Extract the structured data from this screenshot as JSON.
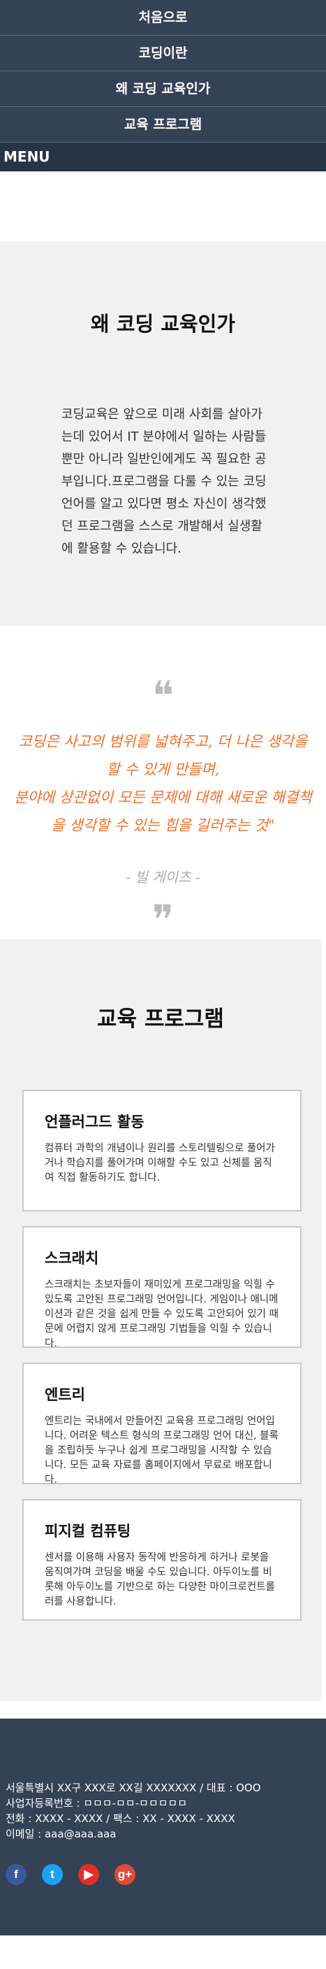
{
  "nav": {
    "items": [
      {
        "label": "처음으로"
      },
      {
        "label": "코딩이란"
      },
      {
        "label": "왜 코딩 교육인가"
      },
      {
        "label": "교육 프로그램"
      }
    ],
    "menu_label": "MENU"
  },
  "why": {
    "title": "왜 코딩 교육인가",
    "body": "코딩교육은 앞으로 미래 사회를 살아가는데 있어서 IT 분야에서 일하는 사람들 뿐만 아니라 일반인에게도 꼭 필요한 공부입니다.프로그램을 다룰 수 있는 코딩 언어를 알고 있다면 평소 자신이 생각했던 프로그램을 스스로 개발해서 실생활에 활용할 수 있습니다."
  },
  "quote": {
    "open_mark": "❝",
    "line1": "코딩은 사고의 범위를 넓혀주고, 더 나은 생각을 할 수 있게 만들며,",
    "line2": "분야에 상관없이 모든 문제에 대해 새로운 해결책을 생각할 수 있는 힘을 길러주는 것\"",
    "author": "- 빌 게이츠 -",
    "close_mark": "❞"
  },
  "program": {
    "title": "교육 프로그램",
    "cards": [
      {
        "title": "언플러그드 활동",
        "body": "컴퓨터 과학의 개념이나 원리를 스토리텔링으로 풀어가거나 학습지를 풀어가며 이해할 수도 있고 신체를 움직여 직접 활동하기도 합니다."
      },
      {
        "title": "스크래치",
        "body": "스크래치는 초보자들이 재미있게 프로그래밍을 익힐 수 있도록 고안된 프로그래밍 언어입니다. 게임이나 애니메이션과 같은 것을 쉽게 만들 수 있도록 고안되어 있기 때문에 어렵지 않게 프로그래밍 기법들을 익힐 수 있습니다."
      },
      {
        "title": "엔트리",
        "body": "엔트리는 국내에서 만들어진 교육용 프로그래밍 언어입니다. 어려운 텍스트 형식의 프로그래밍 언어 대신, 블록을 조립하듯 누구나 쉽게 프로그래밍을 시작할 수 있습니다. 모든 교육 자료를 홈페이지에서 무료로 배포합니다."
      },
      {
        "title": "피지컬 컴퓨팅",
        "body": "센서를 이용해 사용자 동작에 반응하게 하거나 로봇을 움직여가며 코딩을 배울 수도 있습니다. 아두이노를 비롯해 아두이노를 기반으로 하는 다양한 마이크로컨트롤러를 사용합니다."
      }
    ]
  },
  "footer": {
    "address": "서울특별시 XX구 XXX로 XX길 XXXXXXX / 대표 : OOO",
    "business_no": "사업자등록번호 : ㅁㅁㅁ-ㅁㅁ-ㅁㅁㅁㅁㅁ",
    "phone": "전화 : XXXX - XXXX / 팩스 : XX - XXXX - XXXX",
    "email": "이메일 : aaa@aaa.aaa",
    "social": [
      {
        "icon": "facebook-icon",
        "glyph": "f",
        "color": "#3b5998"
      },
      {
        "icon": "twitter-icon",
        "glyph": "t",
        "color": "#1da1f2"
      },
      {
        "icon": "youtube-icon",
        "glyph": "▶",
        "color": "#e52d27"
      },
      {
        "icon": "google-plus-icon",
        "glyph": "g+",
        "color": "#dd4b39"
      }
    ]
  }
}
